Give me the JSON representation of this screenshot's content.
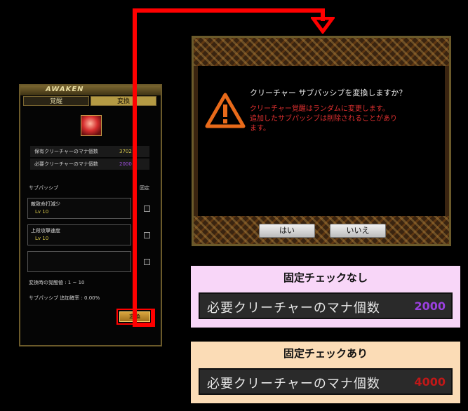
{
  "awaken_panel": {
    "header_title": "AWAKEN",
    "tabs": [
      "覚醒",
      "変換"
    ],
    "owned_mana_label": "保有クリーチャーのマナ個数",
    "owned_mana_value": "3702",
    "required_mana_label": "必要クリーチャーのマナ個数",
    "required_mana_value": "2000",
    "sub_passive_label": "サブパッシブ",
    "fixed_label": "固定",
    "slots": [
      {
        "name": "敵致命打減少",
        "level": "Lv 10"
      },
      {
        "name": "上段攻撃速度",
        "level": "Lv 10"
      },
      {
        "name": "",
        "level": ""
      }
    ],
    "awaken_value_text": "変換時の覚醒値 : 1 ~ 10",
    "add_chance_text": "サブパッシブ 追加確率 : 0.00%",
    "convert_button": "変換"
  },
  "dialog": {
    "question": "クリーチャー サブパッシブを変換しますか？",
    "warning_lines": [
      "クリーチャー覚醒はランダムに変更します。",
      "追加したサブパッシブは削除されることがあり",
      "ます。"
    ],
    "yes_button": "はい",
    "no_button": "いいえ"
  },
  "info_boxes": [
    {
      "title": "固定チェックなし",
      "label": "必要クリーチャーのマナ個数",
      "value": "2000",
      "value_color": "#9b40e0"
    },
    {
      "title": "固定チェックあり",
      "label": "必要クリーチャーのマナ個数",
      "value": "4000",
      "value_color": "#c01818"
    }
  ],
  "colors": {
    "arrow": "#ff0000",
    "warning": "#e03030",
    "gold": "#b49a44"
  },
  "icons": {
    "warning": "warning-triangle-icon",
    "portrait": "creature-portrait-icon",
    "checkbox": "checkbox-icon"
  }
}
